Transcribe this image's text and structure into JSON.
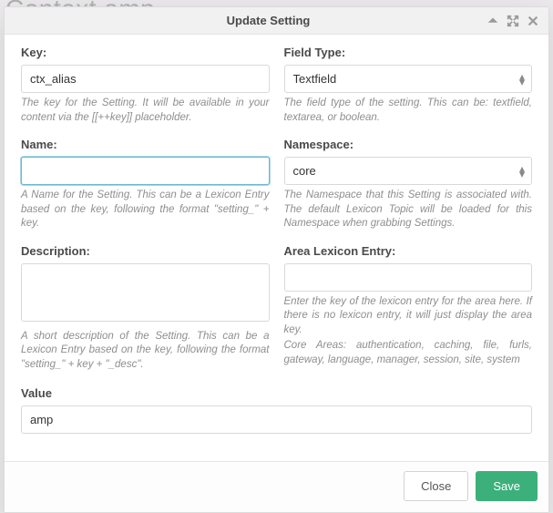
{
  "background_title": "Context amp",
  "modal": {
    "title": "Update Setting",
    "buttons": {
      "close": "Close",
      "save": "Save"
    }
  },
  "left": {
    "key": {
      "label": "Key:",
      "value": "ctx_alias",
      "help": "The key for the Setting. It will be available in your content via the [[++key]] placeholder."
    },
    "name": {
      "label": "Name:",
      "value": "",
      "help": "A Name for the Setting. This can be a Lexicon Entry based on the key, following the format \"setting_\" + key."
    },
    "description": {
      "label": "Description:",
      "value": "",
      "help": "A short description of the Setting. This can be a Lexicon Entry based on the key, following the format \"setting_\" + key + \"_desc\"."
    }
  },
  "right": {
    "field_type": {
      "label": "Field Type:",
      "value": "Textfield",
      "help": "The field type of the setting. This can be: textfield, textarea, or boolean."
    },
    "namespace": {
      "label": "Namespace:",
      "value": "core",
      "help": "The Namespace that this Setting is associated with. The default Lexicon Topic will be loaded for this Namespace when grabbing Settings."
    },
    "area": {
      "label": "Area Lexicon Entry:",
      "value": "",
      "help": "Enter the key of the lexicon entry for the area here. If there is no lexicon entry, it will just display the area key.",
      "help2": "Core Areas: authentication, caching, file, furls, gateway, language, manager, session, site, system"
    }
  },
  "value": {
    "label": "Value",
    "value": "amp"
  }
}
